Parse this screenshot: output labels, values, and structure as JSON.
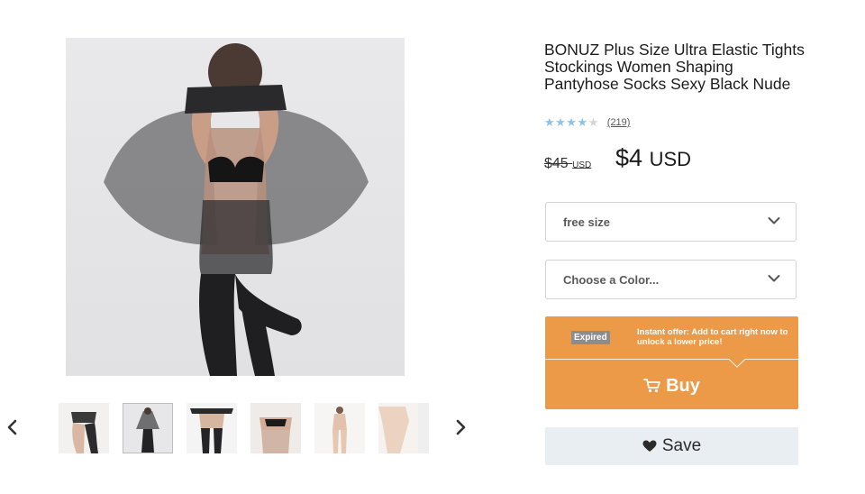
{
  "product": {
    "title": "BONUZ Plus Size Ultra Elastic Tights Stockings Women Shaping Pantyhose Socks Sexy Black Nude",
    "rating": {
      "stars": 4,
      "max": 5,
      "review_count": "(219)"
    },
    "price": {
      "original": "$45",
      "original_currency": "USD",
      "current": "$4",
      "current_currency": "USD"
    }
  },
  "options": {
    "size": {
      "selected": "free size"
    },
    "color": {
      "placeholder": "Choose a Color..."
    }
  },
  "offer": {
    "badge": "Expired",
    "text": "Instant offer: Add to cart right now to unlock a lower price!"
  },
  "actions": {
    "buy_label": "Buy",
    "save_label": "Save"
  },
  "gallery": {
    "thumbnail_count": 6,
    "selected_index": 1,
    "icons": {
      "prev": "chevron-left-icon",
      "next": "chevron-right-icon"
    }
  },
  "colors": {
    "offer_background": "#ec9a48",
    "expired_badge": "#8c8c8c",
    "save_background": "#e9eef2",
    "star_color": "#8dc3e6"
  }
}
